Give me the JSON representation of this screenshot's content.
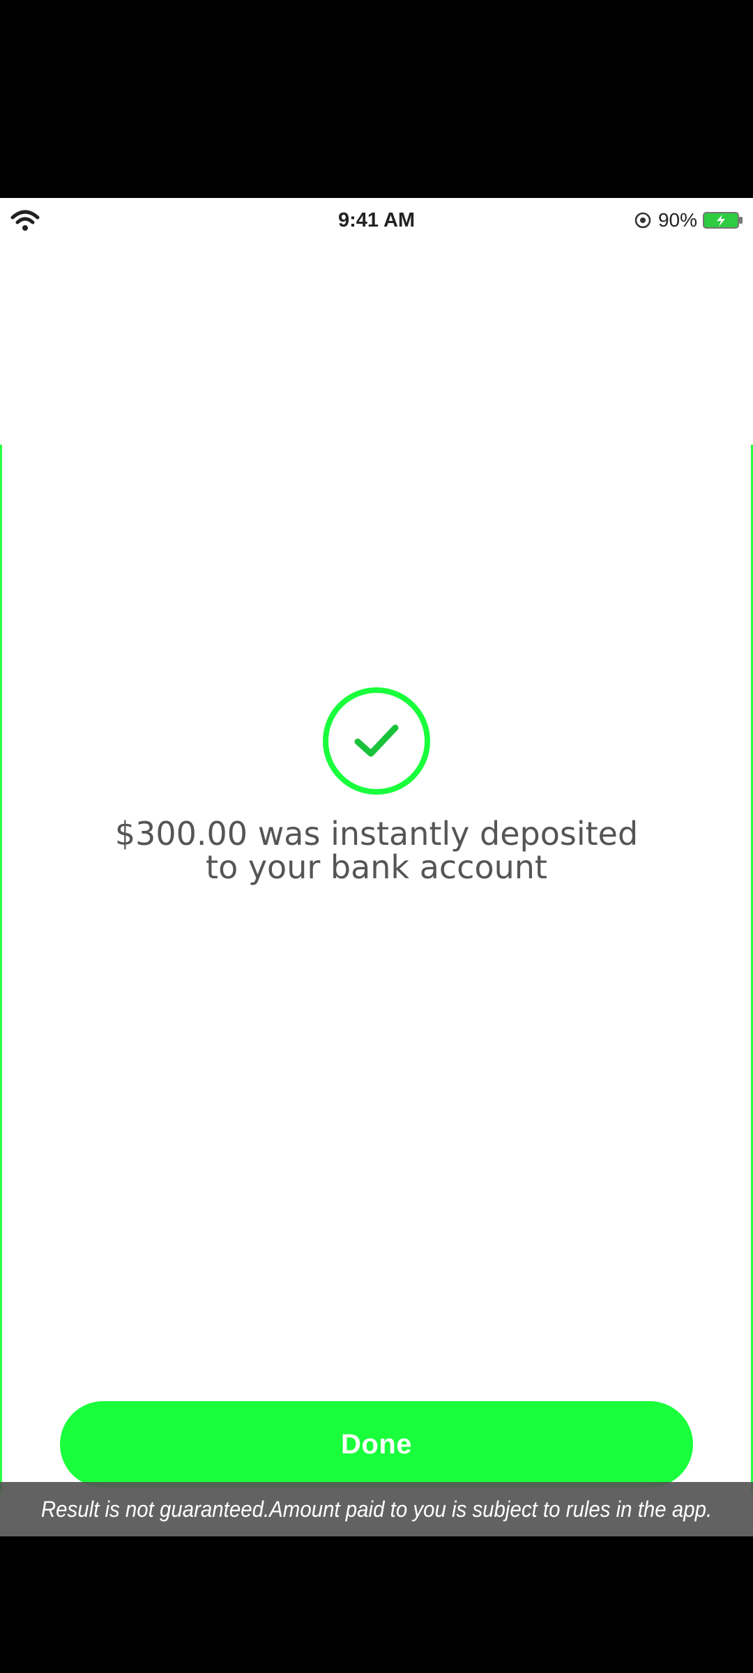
{
  "status_bar": {
    "time": "9:41 AM",
    "battery_percent": "90%",
    "icons": [
      "wifi-icon",
      "location-icon",
      "battery-charging-icon"
    ]
  },
  "confirmation": {
    "icon": "check-circle-icon",
    "message_line1": "$300.00 was instantly deposited",
    "message_line2": "to your bank account"
  },
  "actions": {
    "done_label": "Done"
  },
  "disclaimer": {
    "text": "Result is not guaranteed.Amount paid to you is subject to rules in the app."
  },
  "colors": {
    "accent_green": "#19ff3c",
    "message_text": "#555555",
    "disclaimer_bg": "#555555"
  }
}
